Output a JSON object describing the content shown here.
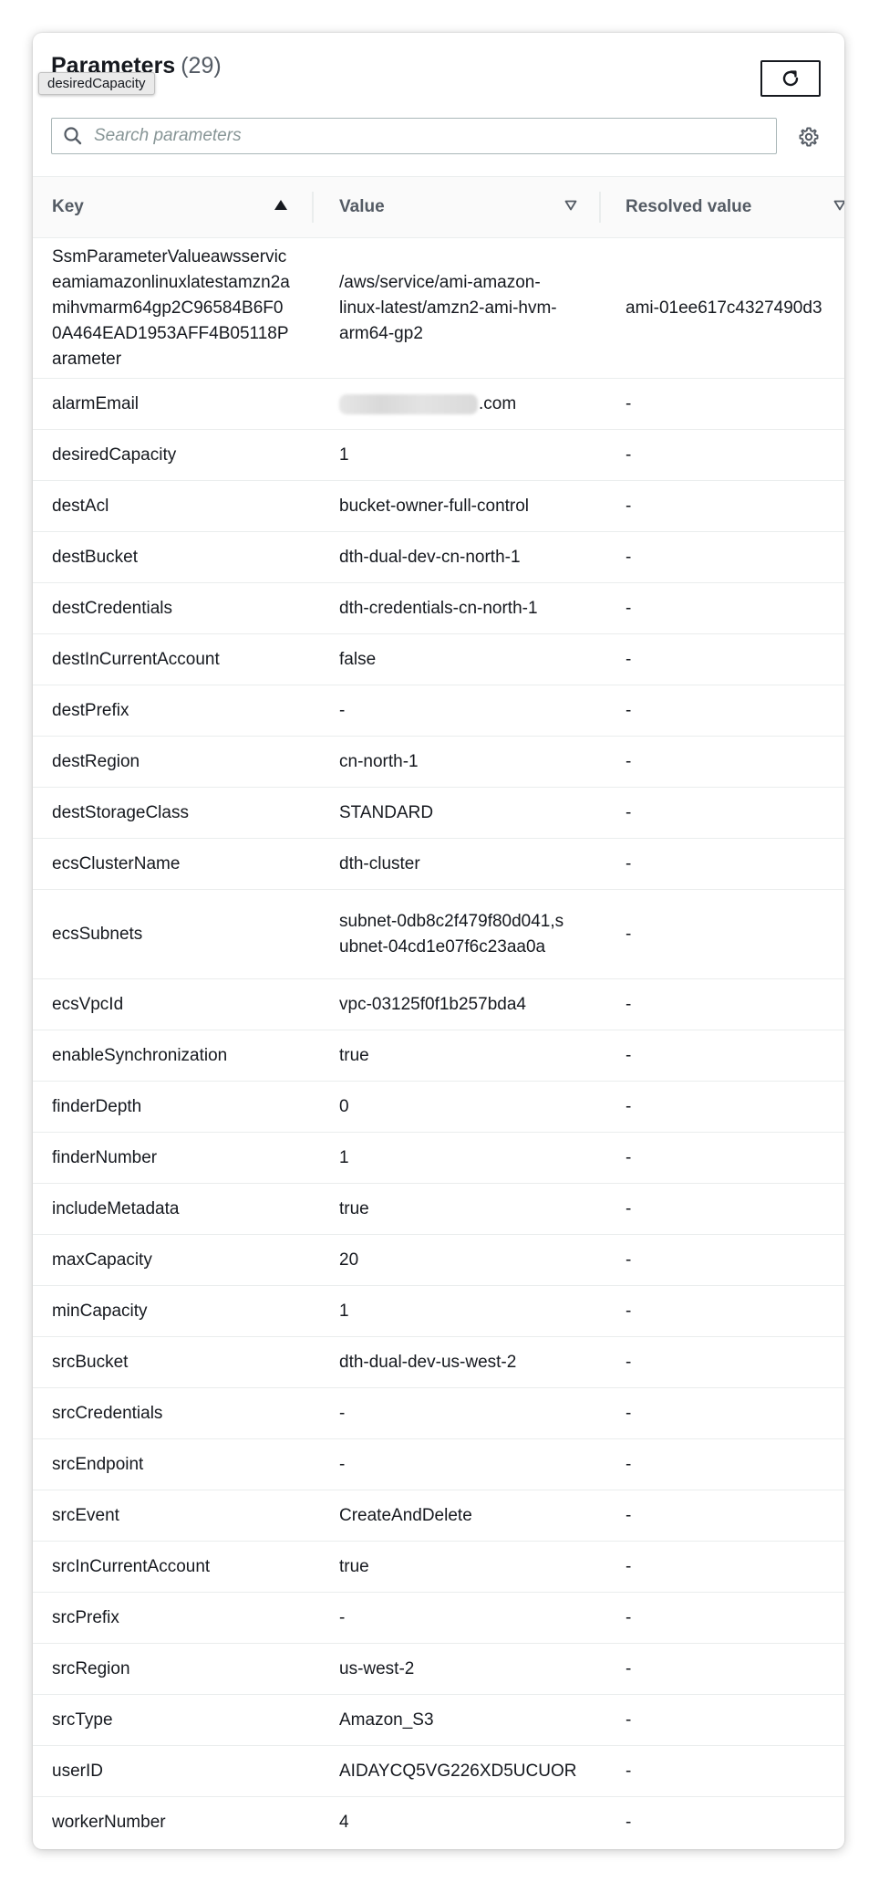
{
  "header": {
    "title": "Parameters",
    "count": "(29)",
    "tooltip": "desiredCapacity",
    "refresh_icon": "refresh-icon",
    "settings_icon": "gear-icon"
  },
  "search": {
    "placeholder": "Search parameters",
    "value": ""
  },
  "table": {
    "columns": [
      {
        "label": "Key",
        "sort": "ascending"
      },
      {
        "label": "Value",
        "sort": "none"
      },
      {
        "label": "Resolved value",
        "sort": "none"
      }
    ],
    "rows": [
      {
        "key": "SsmParameterValueawsserviceamiamazonlinuxlatestamzn2amihvmarm64gp2C96584B6F00A464EAD1953AFF4B05118Parameter",
        "value": "/aws/service/ami-amazon-linux-latest/amzn2-ami-hvm-arm64-gp2",
        "resolved": "ami-01ee617c4327490d3"
      },
      {
        "key": "alarmEmail",
        "value": ".com",
        "resolved": "-",
        "redacted": true
      },
      {
        "key": "desiredCapacity",
        "value": "1",
        "resolved": "-"
      },
      {
        "key": "destAcl",
        "value": "bucket-owner-full-control",
        "resolved": "-"
      },
      {
        "key": "destBucket",
        "value": "dth-dual-dev-cn-north-1",
        "resolved": "-"
      },
      {
        "key": "destCredentials",
        "value": "dth-credentials-cn-north-1",
        "resolved": "-"
      },
      {
        "key": "destInCurrentAccount",
        "value": "false",
        "resolved": "-"
      },
      {
        "key": "destPrefix",
        "value": "-",
        "resolved": "-"
      },
      {
        "key": "destRegion",
        "value": "cn-north-1",
        "resolved": "-"
      },
      {
        "key": "destStorageClass",
        "value": "STANDARD",
        "resolved": "-"
      },
      {
        "key": "ecsClusterName",
        "value": "dth-cluster",
        "resolved": "-"
      },
      {
        "key": "ecsSubnets",
        "value": "subnet-0db8c2f479f80d041,subnet-04cd1e07f6c23aa0a",
        "resolved": "-"
      },
      {
        "key": "ecsVpcId",
        "value": "vpc-03125f0f1b257bda4",
        "resolved": "-"
      },
      {
        "key": "enableSynchronization",
        "value": "true",
        "resolved": "-"
      },
      {
        "key": "finderDepth",
        "value": "0",
        "resolved": "-"
      },
      {
        "key": "finderNumber",
        "value": "1",
        "resolved": "-"
      },
      {
        "key": "includeMetadata",
        "value": "true",
        "resolved": "-"
      },
      {
        "key": "maxCapacity",
        "value": "20",
        "resolved": "-"
      },
      {
        "key": "minCapacity",
        "value": "1",
        "resolved": "-"
      },
      {
        "key": "srcBucket",
        "value": "dth-dual-dev-us-west-2",
        "resolved": "-"
      },
      {
        "key": "srcCredentials",
        "value": "-",
        "resolved": "-"
      },
      {
        "key": "srcEndpoint",
        "value": "-",
        "resolved": "-"
      },
      {
        "key": "srcEvent",
        "value": "CreateAndDelete",
        "resolved": "-"
      },
      {
        "key": "srcInCurrentAccount",
        "value": "true",
        "resolved": "-"
      },
      {
        "key": "srcPrefix",
        "value": "-",
        "resolved": "-"
      },
      {
        "key": "srcRegion",
        "value": "us-west-2",
        "resolved": "-"
      },
      {
        "key": "srcType",
        "value": "Amazon_S3",
        "resolved": "-"
      },
      {
        "key": "userID",
        "value": "AIDAYCQ5VG226XD5UCUOR",
        "resolved": "-"
      },
      {
        "key": "workerNumber",
        "value": "4",
        "resolved": "-"
      }
    ]
  }
}
